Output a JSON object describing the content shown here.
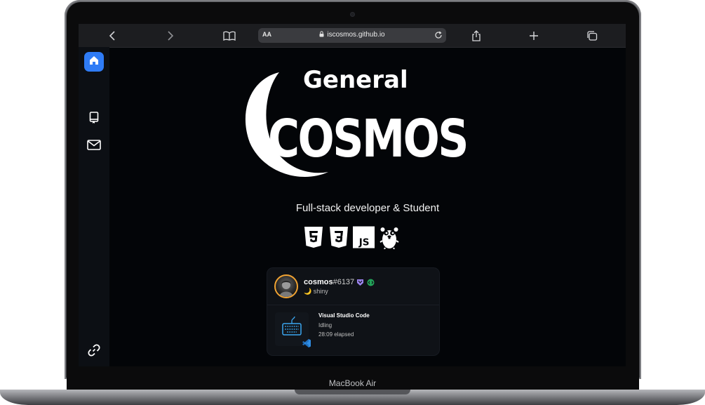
{
  "browser": {
    "url_display": "iscosmos.github.io",
    "reader_label": "AA"
  },
  "sidebar": {
    "items": [
      {
        "name": "home",
        "icon": "home-icon",
        "active": true
      },
      {
        "name": "repo",
        "icon": "repo-icon",
        "active": false
      },
      {
        "name": "mail",
        "icon": "mail-icon",
        "active": false
      }
    ],
    "bottom_icon": "link-icon"
  },
  "hero": {
    "logo_top": "General",
    "logo_main": "COSMOS",
    "tagline": "Full-stack developer & Student",
    "tech": [
      "html5-icon",
      "css3-icon",
      "javascript-icon",
      "go-gopher-icon"
    ]
  },
  "discord": {
    "username": "cosmos",
    "discriminator": "#6137",
    "status_emoji": "🌙",
    "status_text": "shiny",
    "status_color": "#f0a332",
    "activity": {
      "title": "Visual Studio Code",
      "state": "Idling",
      "elapsed": "28:09 elapsed"
    }
  },
  "device": {
    "model": "MacBook Air"
  },
  "colors": {
    "accent": "#2f7cf6",
    "background": "#030508",
    "card": "#0f1217"
  }
}
